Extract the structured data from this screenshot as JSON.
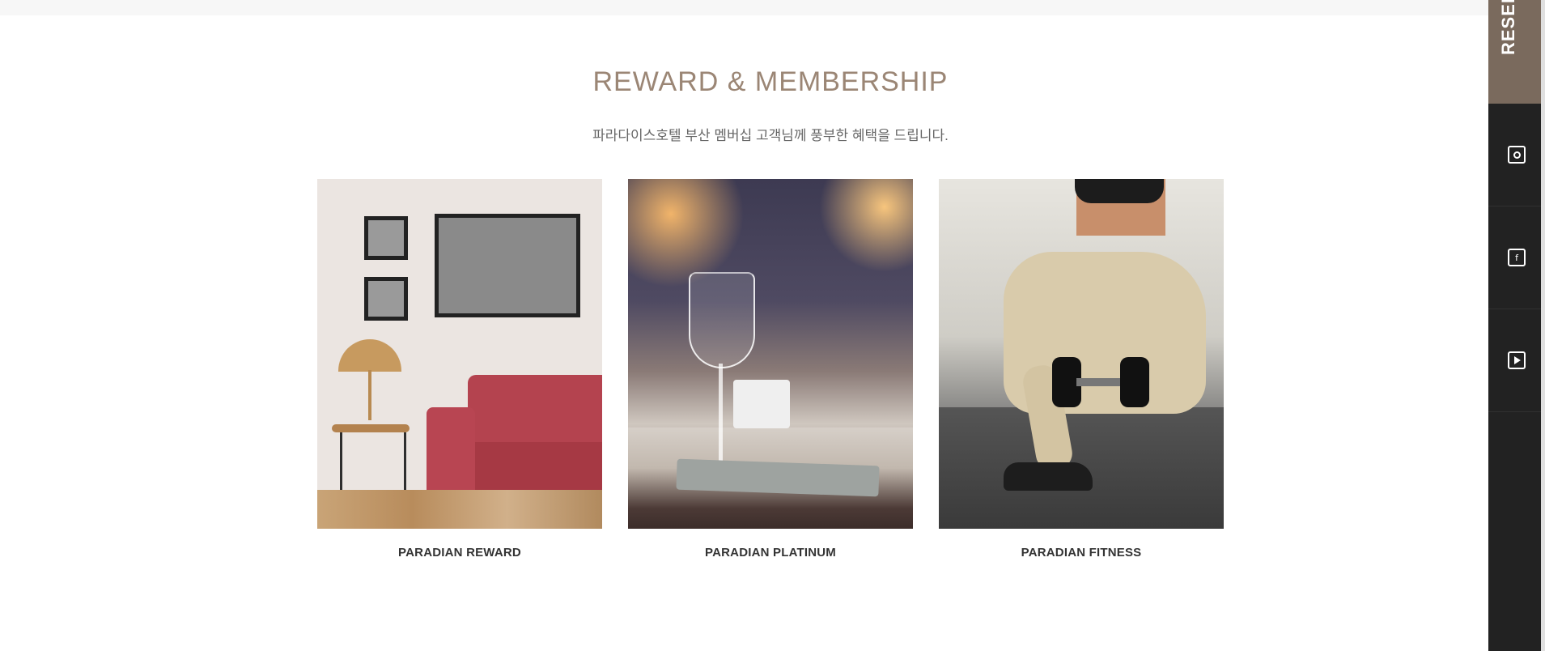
{
  "section": {
    "title": "REWARD & MEMBERSHIP",
    "subtitle": "파라다이스호텔 부산 멤버십 고객님께 풍부한 혜택을 드립니다."
  },
  "cards": [
    {
      "label": "PARADIAN REWARD",
      "image": "living-room-photo"
    },
    {
      "label": "PARADIAN PLATINUM",
      "image": "wine-glass-photo"
    },
    {
      "label": "PARADIAN FITNESS",
      "image": "fitness-photo"
    }
  ],
  "sidebar": {
    "reserve_label": "RESERV",
    "sns": [
      {
        "icon": "instagram-icon"
      },
      {
        "icon": "facebook-icon",
        "glyph": "f"
      },
      {
        "icon": "youtube-icon"
      }
    ]
  },
  "colors": {
    "accent": "#9b8675",
    "sidebar_bg": "#222222",
    "reserve_bg": "#7a6a5d"
  }
}
